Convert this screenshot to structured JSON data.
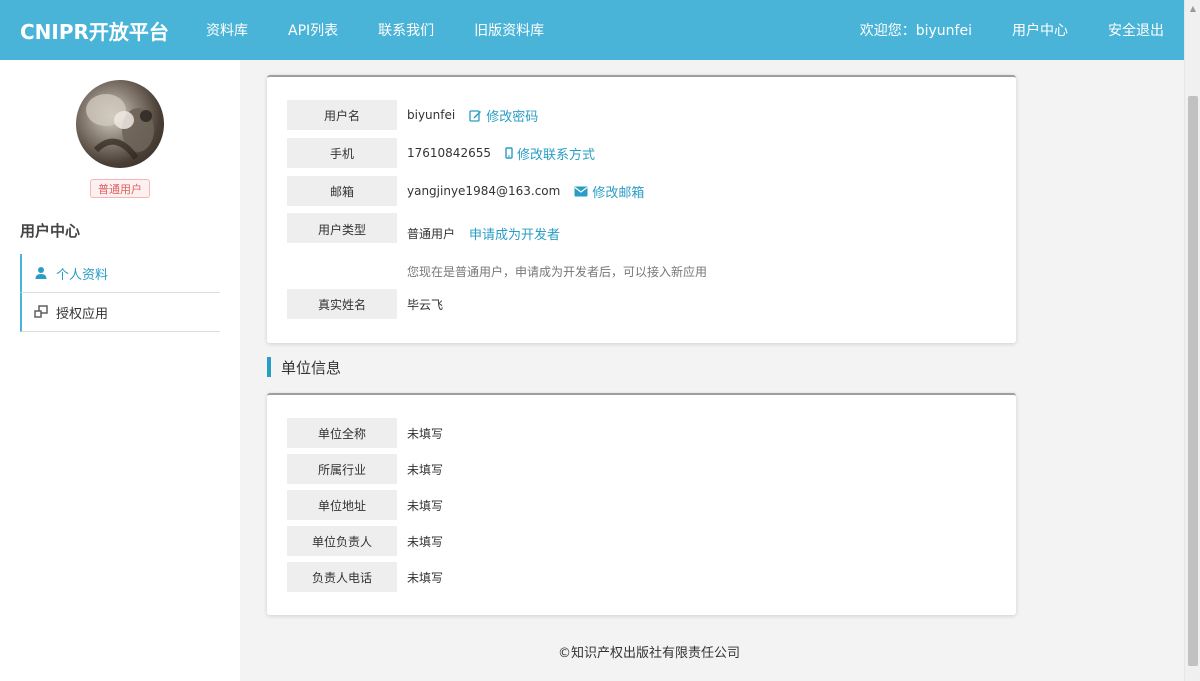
{
  "navbar": {
    "brand": "CNIPR开放平台",
    "links": [
      "资料库",
      "API列表",
      "联系我们",
      "旧版资料库"
    ],
    "welcome": "欢迎您：biyunfei",
    "user_center": "用户中心",
    "logout": "安全退出"
  },
  "sidebar": {
    "badge": "普通用户",
    "title": "用户中心",
    "items": [
      {
        "label": "个人资料",
        "icon": "user-icon"
      },
      {
        "label": "授权应用",
        "icon": "apps-icon"
      }
    ]
  },
  "profile": {
    "username": {
      "label": "用户名",
      "value": "biyunfei",
      "action": "修改密码"
    },
    "phone": {
      "label": "手机",
      "value": "17610842655",
      "action": "修改联系方式"
    },
    "email": {
      "label": "邮箱",
      "value": "yangjinye1984@163.com",
      "action": "修改邮箱"
    },
    "user_type": {
      "label": "用户类型",
      "value": "普通用户",
      "action": "申请成为开发者",
      "hint": "您现在是普通用户，申请成为开发者后，可以接入新应用"
    },
    "real_name": {
      "label": "真实姓名",
      "value": "毕云飞"
    }
  },
  "org": {
    "section_title": "单位信息",
    "rows": [
      {
        "label": "单位全称",
        "value": "未填写"
      },
      {
        "label": "所属行业",
        "value": "未填写"
      },
      {
        "label": "单位地址",
        "value": "未填写"
      },
      {
        "label": "单位负责人",
        "value": "未填写"
      },
      {
        "label": "负责人电话",
        "value": "未填写"
      }
    ]
  },
  "footer": "©知识产权出版社有限责任公司",
  "colors": {
    "navbar": "#4ab4d8",
    "accent": "#2a9dc4",
    "badge_text": "#e06060"
  }
}
